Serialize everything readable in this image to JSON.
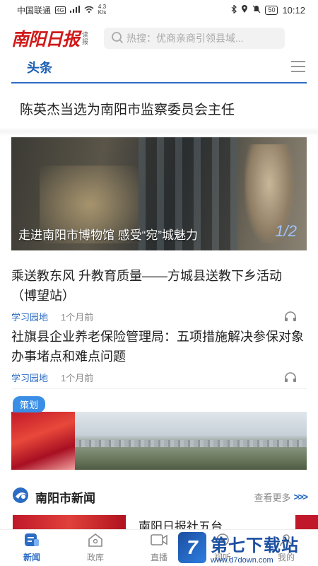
{
  "status_bar": {
    "carrier": "中国联通",
    "network": "4G",
    "speed_value": "4.3",
    "speed_unit": "K/s",
    "battery": "50",
    "time": "10:12"
  },
  "header": {
    "logo": "南阳日报",
    "logo_sub_1": "读",
    "logo_sub_2": "报",
    "search_placeholder": "热搜：优商亲商引领县域..."
  },
  "tabs": {
    "active": "头条"
  },
  "headline": "陈英杰当选为南阳市监察委员会主任",
  "banner": {
    "caption": "走进南阳市博物馆 感受“宛”城魅力",
    "page_indicator": "1/2"
  },
  "articles": [
    {
      "title": "乘送教东风 升教育质量——方城县送教下乡活动（博望站）",
      "tag": "学习园地",
      "time": "1个月前"
    },
    {
      "title": "社旗县企业养老保险管理局：五项措施解决参保对象办事堵点和难点问题",
      "tag": "学习园地",
      "time": "1个月前"
    }
  ],
  "feature": {
    "tag": "策划"
  },
  "section": {
    "title": "南阳市新闻",
    "more": "查看更多",
    "arrows": ">>>"
  },
  "preview": {
    "title": "南阳日报社五台"
  },
  "bottom_nav": [
    {
      "label": "新闻",
      "icon": "news-icon",
      "active": true
    },
    {
      "label": "政库",
      "icon": "home-icon",
      "active": false
    },
    {
      "label": "直播",
      "icon": "video-icon",
      "active": false
    },
    {
      "label": "视听",
      "icon": "play-icon",
      "active": false
    },
    {
      "label": "我的",
      "icon": "user-icon",
      "active": false
    }
  ],
  "watermark": {
    "logo_letter": "7",
    "text": "第七下载站",
    "url": "www.d7down.com"
  },
  "colors": {
    "accent": "#2b6cc4",
    "brand_red": "#d11a1a"
  }
}
